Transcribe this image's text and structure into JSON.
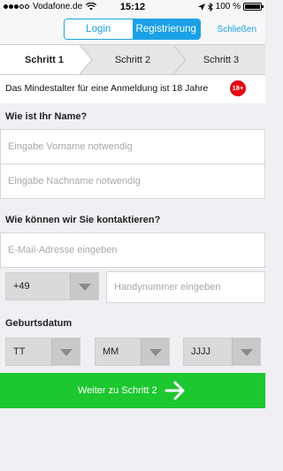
{
  "status_bar": {
    "carrier": "Vodafone.de",
    "time": "15:12",
    "battery": "100 %",
    "battery_level": 1.0
  },
  "nav": {
    "tabs": [
      {
        "label": "Login",
        "active": false
      },
      {
        "label": "Registrierung",
        "active": true
      }
    ],
    "close_label": "Schließen"
  },
  "steps": [
    {
      "label": "Schritt 1",
      "active": true
    },
    {
      "label": "Schritt 2",
      "active": false
    },
    {
      "label": "Schritt 3",
      "active": false
    }
  ],
  "notice": {
    "text": "Das Mindestalter für eine Anmeldung ist 18 Jahre",
    "badge": "18+"
  },
  "name_section": {
    "title": "Wie ist Ihr Name?",
    "first_name_placeholder": "Eingabe Vorname notwendig",
    "last_name_placeholder": "Eingabe Nachname notwendig"
  },
  "contact_section": {
    "title": "Wie können wir Sie kontaktieren?",
    "email_placeholder": "E-Mail-Adresse eingeben",
    "country_code": "+49",
    "phone_placeholder": "Handynummer eingeben"
  },
  "birth_section": {
    "title": "Geburtsdatum",
    "day": "TT",
    "month": "MM",
    "year": "JJJJ"
  },
  "cta": {
    "label": "Weiter zu Schritt 2"
  },
  "colors": {
    "accent": "#1aa0e6",
    "cta": "#1dc730",
    "badge": "#e30613"
  }
}
